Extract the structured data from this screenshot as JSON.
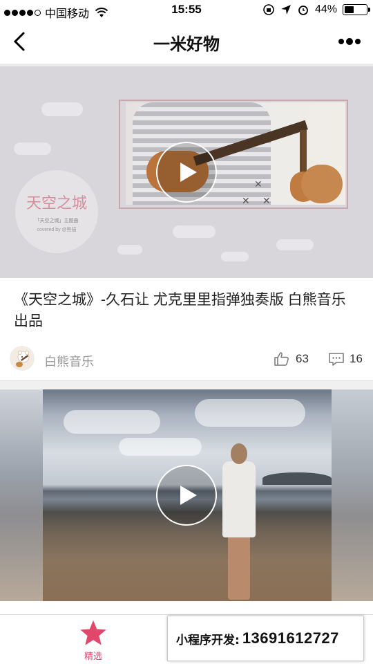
{
  "status_bar": {
    "carrier": "中国移动",
    "time": "15:55",
    "battery": "44%",
    "battery_level": 0.44
  },
  "nav": {
    "title": "一米好物",
    "back_icon": "chevron-left-icon",
    "more_icon": "more-icon"
  },
  "feed": [
    {
      "thumbnail_text": "天空之城",
      "thumbnail_sub": "「天空之城」主题曲",
      "thumbnail_credit": "covered by @熊猫",
      "title": "《天空之城》-久石让 尤克里里指弹独奏版 白熊音乐出品",
      "author": "白熊音乐",
      "likes": "63",
      "comments": "16"
    },
    {
      "title": ""
    }
  ],
  "tab_bar": {
    "home_label": "精选",
    "home_icon": "star-icon",
    "accent": "#e0476b"
  },
  "promo": {
    "label": "小程序开发:",
    "phone": "13691612727"
  }
}
